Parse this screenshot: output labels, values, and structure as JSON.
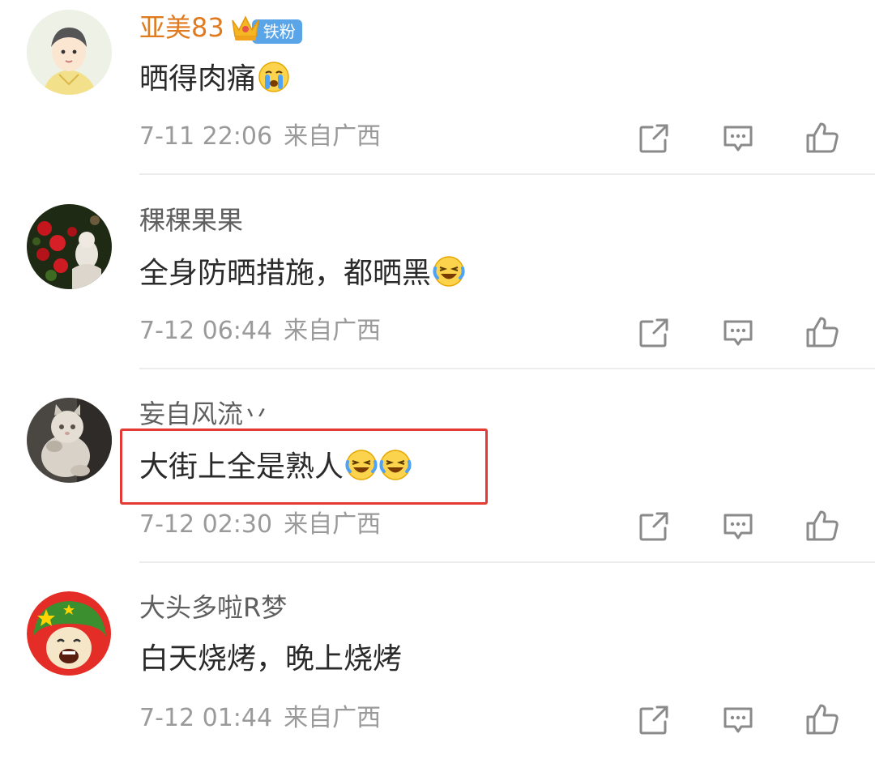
{
  "comments": [
    {
      "username": "亚美83",
      "badge": "铁粉",
      "content": "晒得肉痛",
      "time": "7-11 22:06",
      "location": "来自广西",
      "emojis": [
        "crying-face"
      ]
    },
    {
      "username": "稞稞果果",
      "content": "全身防晒措施，都晒黑",
      "time": "7-12 06:44",
      "location": "来自广西",
      "emojis": [
        "laugh-cry-face"
      ]
    },
    {
      "username": "妄自风流丷",
      "content": "大街上全是熟人",
      "time": "7-12 02:30",
      "location": "来自广西",
      "emojis": [
        "laugh-cry-face",
        "laugh-cry-face"
      ],
      "highlighted": true
    },
    {
      "username": "大头多啦R梦",
      "content": "白天烧烤，晚上烧烤",
      "time": "7-12 01:44",
      "location": "来自广西",
      "emojis": []
    }
  ],
  "icons": {
    "share": "share-icon",
    "reply": "comment-icon",
    "like": "thumbs-up-icon"
  },
  "colors": {
    "vip_username": "#e07a1f",
    "badge_bg": "#5aa4e8",
    "highlight_border": "#e53935",
    "meta_text": "#9a9a9a"
  }
}
